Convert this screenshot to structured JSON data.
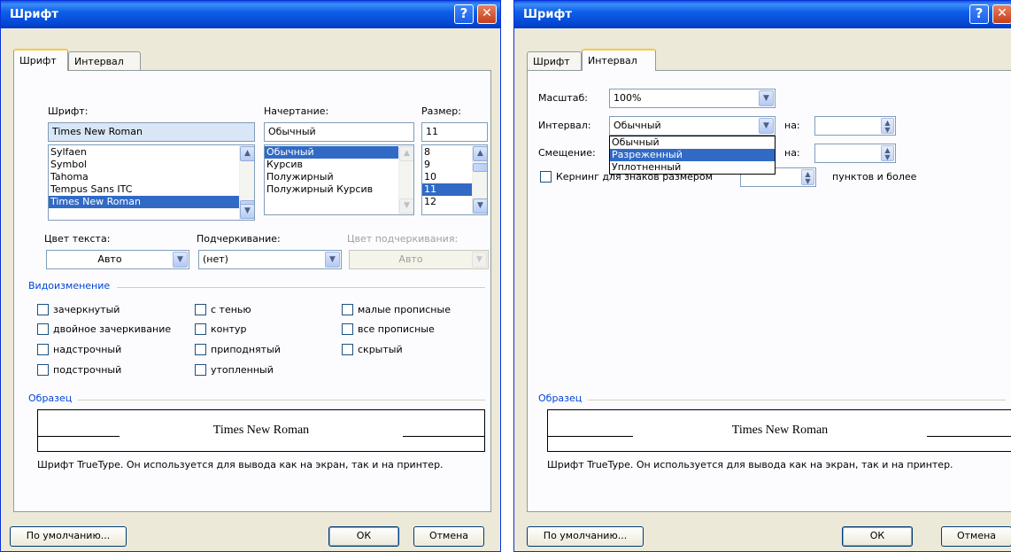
{
  "left": {
    "title": "Шрифт",
    "tabs": [
      "Шрифт",
      "Интервал"
    ],
    "font_label": "Шрифт:",
    "font_value": "Times New Roman",
    "font_list": [
      "Sylfaen",
      "Symbol",
      "Tahoma",
      "Tempus Sans ITC",
      "Times New Roman"
    ],
    "style_label": "Начертание:",
    "style_value": "Обычный",
    "style_list": [
      "Обычный",
      "Курсив",
      "Полужирный",
      "Полужирный Курсив"
    ],
    "size_label": "Размер:",
    "size_value": "11",
    "size_list": [
      "8",
      "9",
      "10",
      "11",
      "12"
    ],
    "color_label": "Цвет текста:",
    "color_value": "Авто",
    "underline_label": "Подчеркивание:",
    "underline_value": "(нет)",
    "underline_color_label": "Цвет подчеркивания:",
    "underline_color_value": "Авто",
    "effects_group": "Видоизменение",
    "effects": [
      "зачеркнутый",
      "двойное зачеркивание",
      "надстрочный",
      "подстрочный",
      "с тенью",
      "контур",
      "приподнятый",
      "утопленный",
      "малые прописные",
      "все прописные",
      "скрытый"
    ],
    "sample_group": "Образец",
    "sample_text": "Times New Roman",
    "info_text": "Шрифт TrueType. Он используется для вывода как на экран, так и на принтер.",
    "default_button": "По умолчанию...",
    "ok_button": "ОК",
    "cancel_button": "Отмена"
  },
  "right": {
    "title": "Шрифт",
    "tabs": [
      "Шрифт",
      "Интервал"
    ],
    "scale_label": "Масштаб:",
    "scale_value": "100%",
    "spacing_label": "Интервал:",
    "spacing_value": "Обычный",
    "spacing_options": [
      "Обычный",
      "Разреженный",
      "Уплотненный"
    ],
    "position_label": "Смещение:",
    "by_label": "на:",
    "kerning_label": "Кернинг для знаков размером",
    "kerning_suffix": "пунктов и более",
    "sample_group": "Образец",
    "sample_text": "Times New Roman",
    "info_text": "Шрифт TrueType. Он используется для вывода как на экран, так и на принтер.",
    "default_button": "По умолчанию...",
    "ok_button": "ОК",
    "cancel_button": "Отмена"
  }
}
